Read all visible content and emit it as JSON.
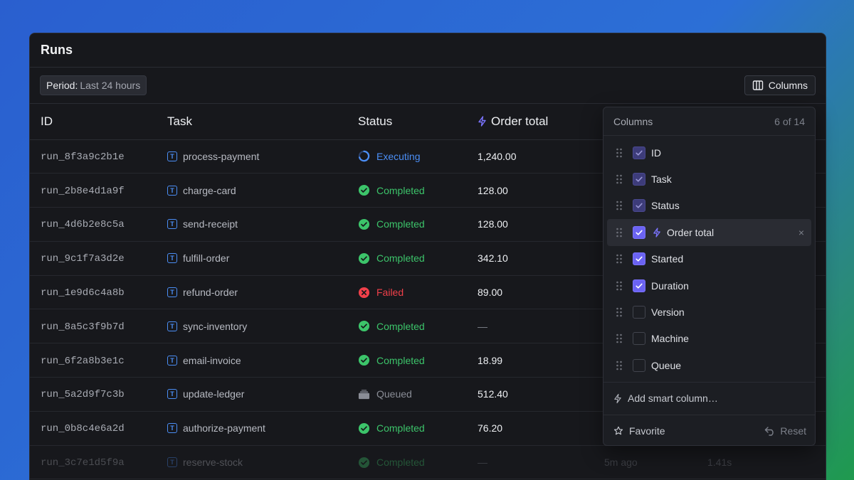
{
  "window": {
    "title": "Runs"
  },
  "toolbar": {
    "period_key": "Period:",
    "period_value": "Last 24 hours",
    "columns_label": "Columns"
  },
  "table": {
    "headers": {
      "id": "ID",
      "task": "Task",
      "status": "Status",
      "order_total": "Order total"
    },
    "rows": [
      {
        "id": "run_8f3a9c2b1e",
        "task": "process-payment",
        "status": "Executing",
        "status_kind": "executing",
        "total": "1,240.00"
      },
      {
        "id": "run_2b8e4d1a9f",
        "task": "charge-card",
        "status": "Completed",
        "status_kind": "completed",
        "total": "128.00"
      },
      {
        "id": "run_4d6b2e8c5a",
        "task": "send-receipt",
        "status": "Completed",
        "status_kind": "completed",
        "total": "128.00"
      },
      {
        "id": "run_9c1f7a3d2e",
        "task": "fulfill-order",
        "status": "Completed",
        "status_kind": "completed",
        "total": "342.10"
      },
      {
        "id": "run_1e9d6c4a8b",
        "task": "refund-order",
        "status": "Failed",
        "status_kind": "failed",
        "total": "89.00"
      },
      {
        "id": "run_8a5c3f9b7d",
        "task": "sync-inventory",
        "status": "Completed",
        "status_kind": "completed",
        "total": "—"
      },
      {
        "id": "run_6f2a8b3e1c",
        "task": "email-invoice",
        "status": "Completed",
        "status_kind": "completed",
        "total": "18.99"
      },
      {
        "id": "run_5a2d9f7c3b",
        "task": "update-ledger",
        "status": "Queued",
        "status_kind": "queued",
        "total": "512.40"
      },
      {
        "id": "run_0b8c4e6a2d",
        "task": "authorize-payment",
        "status": "Completed",
        "status_kind": "completed",
        "total": "76.20"
      },
      {
        "id": "run_3c7e1d5f9a",
        "task": "reserve-stock",
        "status": "Completed",
        "status_kind": "completed",
        "total": "—",
        "started": "5m ago",
        "duration": "1.41s"
      }
    ]
  },
  "columns_panel": {
    "title": "Columns",
    "count": "6 of 14",
    "items": [
      {
        "label": "ID",
        "state": "locked"
      },
      {
        "label": "Task",
        "state": "locked"
      },
      {
        "label": "Status",
        "state": "locked"
      },
      {
        "label": "Order total",
        "state": "on",
        "smart": true
      },
      {
        "label": "Started",
        "state": "on"
      },
      {
        "label": "Duration",
        "state": "on"
      },
      {
        "label": "Version",
        "state": "off"
      },
      {
        "label": "Machine",
        "state": "off"
      },
      {
        "label": "Queue",
        "state": "off"
      }
    ],
    "remove_icon": "×",
    "add_smart_label": "Add smart column…",
    "favorite_label": "Favorite",
    "reset_label": "Reset"
  },
  "colors": {
    "executing": "#4b8ef5",
    "completed": "#3cc46a",
    "failed": "#f0404a",
    "queued": "#8a8d96",
    "accent": "#6b63f2"
  }
}
